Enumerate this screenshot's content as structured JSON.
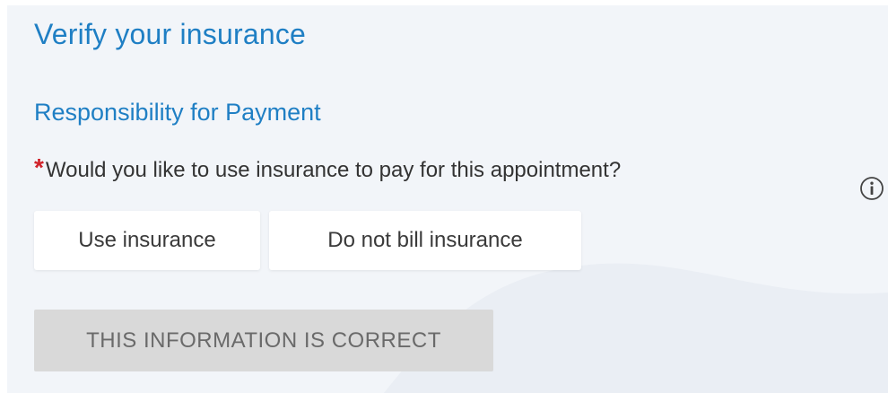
{
  "page": {
    "title": "Verify your insurance",
    "section_title": "Responsibility for Payment"
  },
  "question": {
    "required_marker": "*",
    "text": "Would you like to use insurance to pay for this appointment?",
    "info_icon": "info-circle-icon"
  },
  "options": {
    "use_insurance": "Use insurance",
    "do_not_bill": "Do not bill insurance"
  },
  "confirm": {
    "label": "THIS INFORMATION IS CORRECT",
    "state": "disabled"
  },
  "colors": {
    "heading": "#1f7fc4",
    "required": "#d0222a",
    "panel_background": "#f2f5f9",
    "disabled_button": "#d9d9d9"
  }
}
